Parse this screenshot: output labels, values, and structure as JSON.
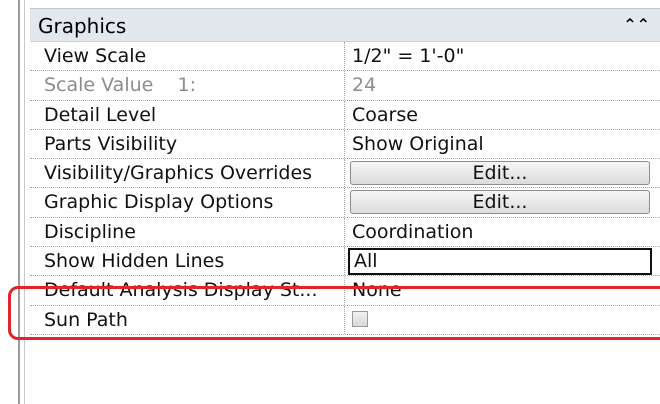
{
  "group": {
    "title": "Graphics",
    "collapse_glyph": "ˆˆ"
  },
  "rows": [
    {
      "name": "View Scale",
      "value": "1/2\" = 1'-0\"",
      "type": "text"
    },
    {
      "name": "Scale Value    1:",
      "value": "24",
      "type": "disabled"
    },
    {
      "name": "Detail Level",
      "value": "Coarse",
      "type": "text"
    },
    {
      "name": "Parts Visibility",
      "value": "Show Original",
      "type": "text"
    },
    {
      "name": "Visibility/Graphics Overrides",
      "value": "Edit...",
      "type": "button"
    },
    {
      "name": "Graphic Display Options",
      "value": "Edit...",
      "type": "button"
    },
    {
      "name": "Discipline",
      "value": "Coordination",
      "type": "text"
    },
    {
      "name": "Show Hidden Lines",
      "value": "All",
      "type": "input"
    },
    {
      "name": "Default Analysis Display St...",
      "value": "None",
      "type": "text"
    },
    {
      "name": "Sun Path",
      "value": "",
      "type": "checkbox"
    }
  ],
  "colors": {
    "highlight": "#e0242a",
    "header_bg": "#e3e7ee"
  }
}
